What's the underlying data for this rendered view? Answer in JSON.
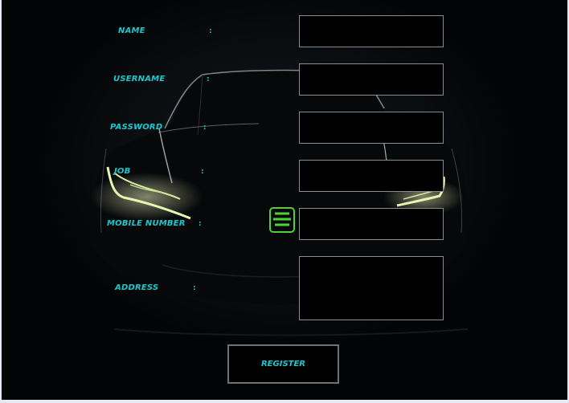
{
  "form": {
    "colon": ":",
    "fields": [
      {
        "label": "NAME",
        "value": ""
      },
      {
        "label": "USERNAME",
        "value": ""
      },
      {
        "label": "PASSWORD",
        "value": ""
      },
      {
        "label": "JOB",
        "value": ""
      },
      {
        "label": "MOBILE NUMBER",
        "value": ""
      },
      {
        "label": "ADDRESS",
        "value": ""
      }
    ],
    "register_label": "REGISTER"
  },
  "colors": {
    "label_text": "#18c9cf",
    "field_border": "#8a8d90",
    "background": "#030405",
    "headlight": "#e6f5b0",
    "logo": "#4ed13a"
  }
}
